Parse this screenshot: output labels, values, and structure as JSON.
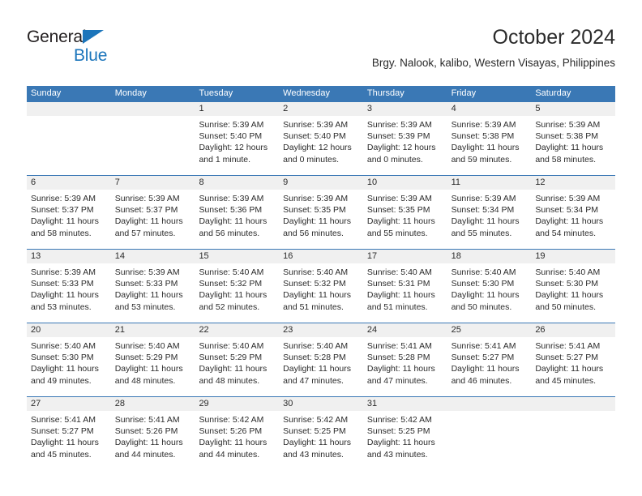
{
  "brand": {
    "line1": "General",
    "line2": "Blue",
    "triangle_color": "#1b75bb",
    "text_color": "#231f20"
  },
  "header": {
    "title": "October 2024",
    "subtitle": "Brgy. Nalook, kalibo, Western Visayas, Philippines"
  },
  "colors": {
    "header_bar": "#3a78b5",
    "daynum_band": "#f0f0f0",
    "text": "#2b2b2b",
    "accent": "#1b75bb"
  },
  "weekdays": [
    "Sunday",
    "Monday",
    "Tuesday",
    "Wednesday",
    "Thursday",
    "Friday",
    "Saturday"
  ],
  "weeks": [
    [
      {
        "day": "",
        "sunrise": "",
        "sunset": "",
        "daylight_1": "",
        "daylight_2": ""
      },
      {
        "day": "",
        "sunrise": "",
        "sunset": "",
        "daylight_1": "",
        "daylight_2": ""
      },
      {
        "day": "1",
        "sunrise": "Sunrise: 5:39 AM",
        "sunset": "Sunset: 5:40 PM",
        "daylight_1": "Daylight: 12 hours",
        "daylight_2": "and 1 minute."
      },
      {
        "day": "2",
        "sunrise": "Sunrise: 5:39 AM",
        "sunset": "Sunset: 5:40 PM",
        "daylight_1": "Daylight: 12 hours",
        "daylight_2": "and 0 minutes."
      },
      {
        "day": "3",
        "sunrise": "Sunrise: 5:39 AM",
        "sunset": "Sunset: 5:39 PM",
        "daylight_1": "Daylight: 12 hours",
        "daylight_2": "and 0 minutes."
      },
      {
        "day": "4",
        "sunrise": "Sunrise: 5:39 AM",
        "sunset": "Sunset: 5:38 PM",
        "daylight_1": "Daylight: 11 hours",
        "daylight_2": "and 59 minutes."
      },
      {
        "day": "5",
        "sunrise": "Sunrise: 5:39 AM",
        "sunset": "Sunset: 5:38 PM",
        "daylight_1": "Daylight: 11 hours",
        "daylight_2": "and 58 minutes."
      }
    ],
    [
      {
        "day": "6",
        "sunrise": "Sunrise: 5:39 AM",
        "sunset": "Sunset: 5:37 PM",
        "daylight_1": "Daylight: 11 hours",
        "daylight_2": "and 58 minutes."
      },
      {
        "day": "7",
        "sunrise": "Sunrise: 5:39 AM",
        "sunset": "Sunset: 5:37 PM",
        "daylight_1": "Daylight: 11 hours",
        "daylight_2": "and 57 minutes."
      },
      {
        "day": "8",
        "sunrise": "Sunrise: 5:39 AM",
        "sunset": "Sunset: 5:36 PM",
        "daylight_1": "Daylight: 11 hours",
        "daylight_2": "and 56 minutes."
      },
      {
        "day": "9",
        "sunrise": "Sunrise: 5:39 AM",
        "sunset": "Sunset: 5:35 PM",
        "daylight_1": "Daylight: 11 hours",
        "daylight_2": "and 56 minutes."
      },
      {
        "day": "10",
        "sunrise": "Sunrise: 5:39 AM",
        "sunset": "Sunset: 5:35 PM",
        "daylight_1": "Daylight: 11 hours",
        "daylight_2": "and 55 minutes."
      },
      {
        "day": "11",
        "sunrise": "Sunrise: 5:39 AM",
        "sunset": "Sunset: 5:34 PM",
        "daylight_1": "Daylight: 11 hours",
        "daylight_2": "and 55 minutes."
      },
      {
        "day": "12",
        "sunrise": "Sunrise: 5:39 AM",
        "sunset": "Sunset: 5:34 PM",
        "daylight_1": "Daylight: 11 hours",
        "daylight_2": "and 54 minutes."
      }
    ],
    [
      {
        "day": "13",
        "sunrise": "Sunrise: 5:39 AM",
        "sunset": "Sunset: 5:33 PM",
        "daylight_1": "Daylight: 11 hours",
        "daylight_2": "and 53 minutes."
      },
      {
        "day": "14",
        "sunrise": "Sunrise: 5:39 AM",
        "sunset": "Sunset: 5:33 PM",
        "daylight_1": "Daylight: 11 hours",
        "daylight_2": "and 53 minutes."
      },
      {
        "day": "15",
        "sunrise": "Sunrise: 5:40 AM",
        "sunset": "Sunset: 5:32 PM",
        "daylight_1": "Daylight: 11 hours",
        "daylight_2": "and 52 minutes."
      },
      {
        "day": "16",
        "sunrise": "Sunrise: 5:40 AM",
        "sunset": "Sunset: 5:32 PM",
        "daylight_1": "Daylight: 11 hours",
        "daylight_2": "and 51 minutes."
      },
      {
        "day": "17",
        "sunrise": "Sunrise: 5:40 AM",
        "sunset": "Sunset: 5:31 PM",
        "daylight_1": "Daylight: 11 hours",
        "daylight_2": "and 51 minutes."
      },
      {
        "day": "18",
        "sunrise": "Sunrise: 5:40 AM",
        "sunset": "Sunset: 5:30 PM",
        "daylight_1": "Daylight: 11 hours",
        "daylight_2": "and 50 minutes."
      },
      {
        "day": "19",
        "sunrise": "Sunrise: 5:40 AM",
        "sunset": "Sunset: 5:30 PM",
        "daylight_1": "Daylight: 11 hours",
        "daylight_2": "and 50 minutes."
      }
    ],
    [
      {
        "day": "20",
        "sunrise": "Sunrise: 5:40 AM",
        "sunset": "Sunset: 5:30 PM",
        "daylight_1": "Daylight: 11 hours",
        "daylight_2": "and 49 minutes."
      },
      {
        "day": "21",
        "sunrise": "Sunrise: 5:40 AM",
        "sunset": "Sunset: 5:29 PM",
        "daylight_1": "Daylight: 11 hours",
        "daylight_2": "and 48 minutes."
      },
      {
        "day": "22",
        "sunrise": "Sunrise: 5:40 AM",
        "sunset": "Sunset: 5:29 PM",
        "daylight_1": "Daylight: 11 hours",
        "daylight_2": "and 48 minutes."
      },
      {
        "day": "23",
        "sunrise": "Sunrise: 5:40 AM",
        "sunset": "Sunset: 5:28 PM",
        "daylight_1": "Daylight: 11 hours",
        "daylight_2": "and 47 minutes."
      },
      {
        "day": "24",
        "sunrise": "Sunrise: 5:41 AM",
        "sunset": "Sunset: 5:28 PM",
        "daylight_1": "Daylight: 11 hours",
        "daylight_2": "and 47 minutes."
      },
      {
        "day": "25",
        "sunrise": "Sunrise: 5:41 AM",
        "sunset": "Sunset: 5:27 PM",
        "daylight_1": "Daylight: 11 hours",
        "daylight_2": "and 46 minutes."
      },
      {
        "day": "26",
        "sunrise": "Sunrise: 5:41 AM",
        "sunset": "Sunset: 5:27 PM",
        "daylight_1": "Daylight: 11 hours",
        "daylight_2": "and 45 minutes."
      }
    ],
    [
      {
        "day": "27",
        "sunrise": "Sunrise: 5:41 AM",
        "sunset": "Sunset: 5:27 PM",
        "daylight_1": "Daylight: 11 hours",
        "daylight_2": "and 45 minutes."
      },
      {
        "day": "28",
        "sunrise": "Sunrise: 5:41 AM",
        "sunset": "Sunset: 5:26 PM",
        "daylight_1": "Daylight: 11 hours",
        "daylight_2": "and 44 minutes."
      },
      {
        "day": "29",
        "sunrise": "Sunrise: 5:42 AM",
        "sunset": "Sunset: 5:26 PM",
        "daylight_1": "Daylight: 11 hours",
        "daylight_2": "and 44 minutes."
      },
      {
        "day": "30",
        "sunrise": "Sunrise: 5:42 AM",
        "sunset": "Sunset: 5:25 PM",
        "daylight_1": "Daylight: 11 hours",
        "daylight_2": "and 43 minutes."
      },
      {
        "day": "31",
        "sunrise": "Sunrise: 5:42 AM",
        "sunset": "Sunset: 5:25 PM",
        "daylight_1": "Daylight: 11 hours",
        "daylight_2": "and 43 minutes."
      },
      {
        "day": "",
        "sunrise": "",
        "sunset": "",
        "daylight_1": "",
        "daylight_2": ""
      },
      {
        "day": "",
        "sunrise": "",
        "sunset": "",
        "daylight_1": "",
        "daylight_2": ""
      }
    ]
  ]
}
